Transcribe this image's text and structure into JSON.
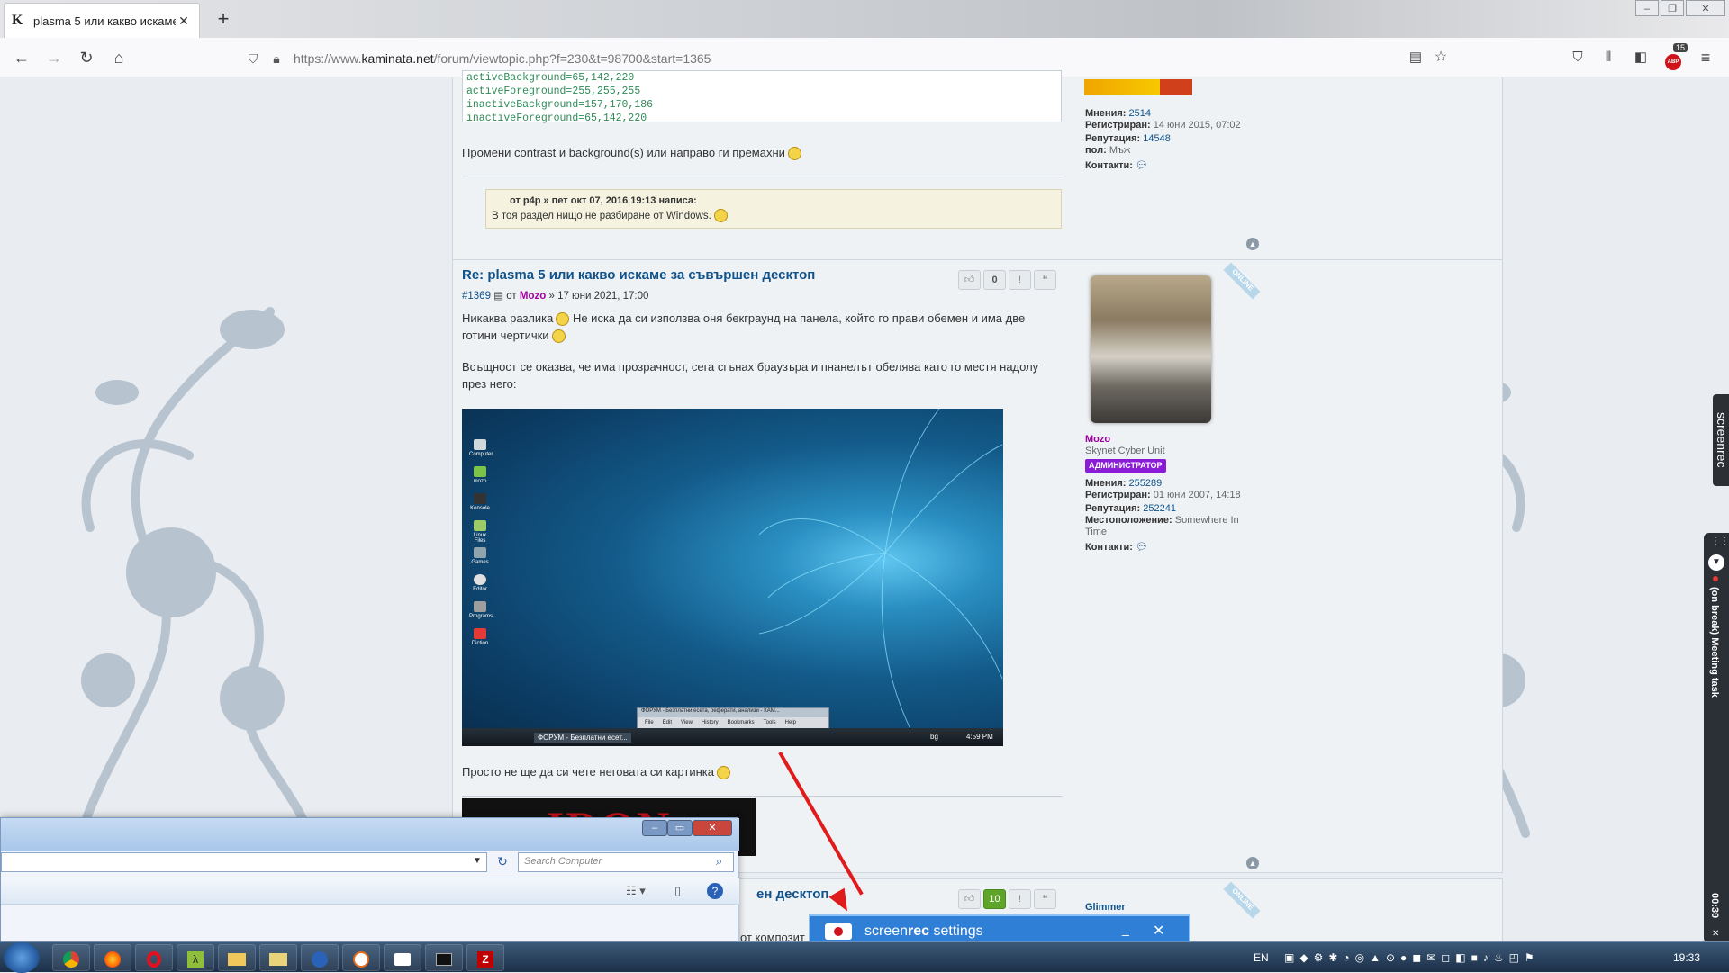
{
  "browser": {
    "tab_title": "plasma 5 или какво искаме за",
    "tab_favicon": "K",
    "url_prefix": "https://www.",
    "url_host": "kaminata.net",
    "url_path": "/forum/viewtopic.php?f=230&t=98700&start=1365",
    "notif_badge": "15",
    "abp_label": "ABP"
  },
  "post1": {
    "code_lines": [
      "activeBackground=65,142,220",
      "activeForeground=255,255,255",
      "inactiveBackground=157,170,186",
      "inactiveForeground=65,142,220"
    ],
    "text": "Промени contrast и background(s) или направо ги премахни",
    "quote_header": "от p4p » пет окт 07, 2016 19:13 написа:",
    "quote_text": "В тоя раздел нищо не разбиране от Windows.",
    "side": {
      "posts_label": "Мнения:",
      "posts": "2514",
      "reg_label": "Регистриран:",
      "reg": "14 юни 2015, 07:02",
      "rep_label": "Репутация:",
      "rep": "14548",
      "sex_label": "пол:",
      "sex": "Мъж",
      "contacts_label": "Контакти:"
    }
  },
  "post2": {
    "title": "Re: plasma 5 или какво искаме за съвършен десктоп",
    "num": "#1369",
    "by": "от",
    "author": "Mozo",
    "date": "» 17 юни 2021, 17:00",
    "votes": "0",
    "text1a": "Никаква разлика",
    "text1b": "Не иска да си използва оня бекграунд на панела, който го прави обемен и има две",
    "text1c": "готини чертички",
    "text2a": "Всъщност се оказва, че има прозрачност, сега сгънах браузъра и пнанелът обелява като го местя надолу",
    "text2b": "през него:",
    "text3": "Просто не ще да си чете неговата си картинка",
    "signature": "IRON MAIDEN",
    "online": "ONLINE",
    "side": {
      "name": "Mozo",
      "title": "Skynet Cyber Unit",
      "rank": "АДМИНИСТРАТОР",
      "posts_label": "Мнения:",
      "posts": "255289",
      "reg_label": "Регистриран:",
      "reg": "01 юни 2007, 14:18",
      "rep_label": "Репутация:",
      "rep": "252241",
      "loc_label": "Местоположение:",
      "loc": "Somewhere In Time",
      "contacts_label": "Контакти:"
    },
    "desktop": {
      "icons": [
        "Computer",
        "mozo",
        "Konsole",
        "Linux Files",
        "Games",
        "Editor",
        "Programs",
        "Diction"
      ],
      "window_title": "ФОРУМ - Безплатни есета, реферати, анализи - КАМ...",
      "menu": [
        "File",
        "Edit",
        "View",
        "History",
        "Bookmarks",
        "Tools",
        "Help"
      ],
      "task_item": "ФОРУМ - Безплатни есет...",
      "clock": "4:59 PM",
      "lang": "bg"
    }
  },
  "post3": {
    "title_tail": "ен десктоп",
    "votes": "10",
    "author": "Glimmer",
    "text_tail": "от композит",
    "online": "ONLINE"
  },
  "explorer": {
    "search_placeholder": "Search Computer"
  },
  "screenrec": {
    "side_label": "screenrec",
    "title_a": "screen",
    "title_b": "rec",
    "title_c": " settings"
  },
  "meeting": {
    "label": "(on break) Meeting task",
    "time": "00:39"
  },
  "taskbar": {
    "lang": "EN",
    "clock": "19:33"
  }
}
